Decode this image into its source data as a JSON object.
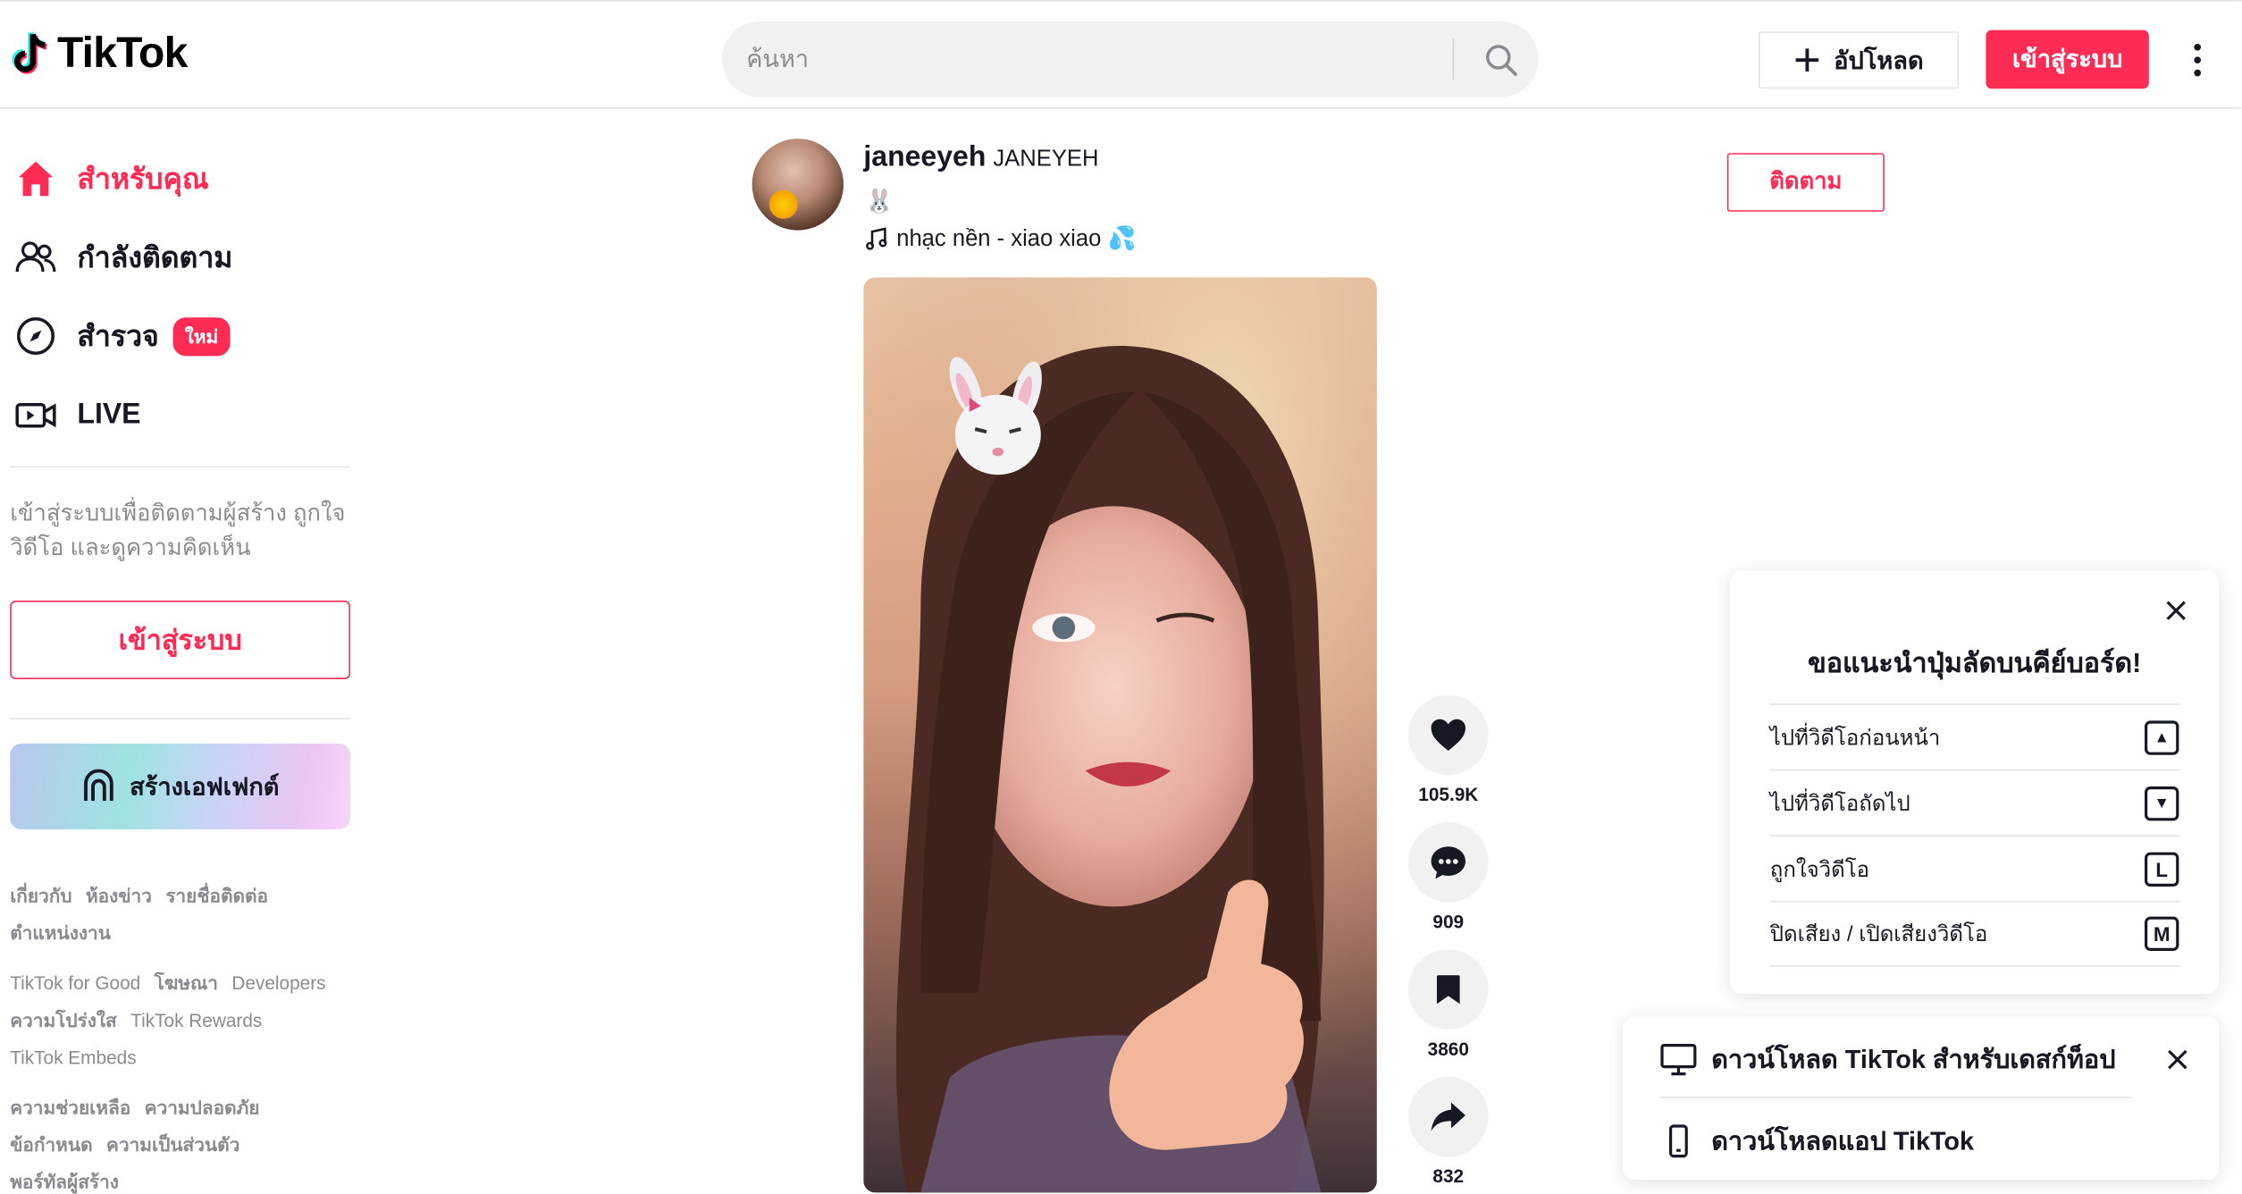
{
  "colors": {
    "brand": "#fe2c55",
    "text": "#161823",
    "muted": "#8a8b91"
  },
  "header": {
    "logo_text": "TikTok",
    "search_placeholder": "ค้นหา",
    "upload_label": "อัปโหลด",
    "login_label": "เข้าสู่ระบบ"
  },
  "sidebar": {
    "nav": [
      {
        "label": "สำหรับคุณ",
        "icon": "home-icon"
      },
      {
        "label": "กำลังติดตาม",
        "icon": "following-users-icon"
      },
      {
        "label": "สำรวจ",
        "icon": "compass-icon",
        "badge": "ใหม่"
      },
      {
        "label": "LIVE",
        "icon": "live-camera-icon"
      }
    ],
    "login_hint": "เข้าสู่ระบบเพื่อติดตามผู้สร้าง ถูกใจวิดีโอ และดูความคิดเห็น",
    "login_button": "เข้าสู่ระบบ",
    "effect_button": "สร้างเอฟเฟกต์",
    "footer": {
      "group1": [
        "เกี่ยวกับ",
        "ห้องข่าว",
        "รายชื่อติดต่อ",
        "ตำแหน่งงาน"
      ],
      "group2": [
        "TikTok for Good",
        "โฆษณา",
        "Developers",
        "ความโปร่งใส",
        "TikTok Rewards",
        "TikTok Embeds"
      ],
      "group3": [
        "ความช่วยเหลือ",
        "ความปลอดภัย",
        "ข้อกำหนด",
        "ความเป็นส่วนตัว",
        "พอร์ทัลผู้สร้าง"
      ]
    }
  },
  "post": {
    "author_name": "janeeyeh",
    "author_nickname": "JANEYEH",
    "caption_emoji": "🐰",
    "music": "nhạc nền - xiao xiao 💦",
    "follow_label": "ติดตาม",
    "actions": [
      {
        "icon": "heart-icon",
        "count": "105.9K"
      },
      {
        "icon": "comment-icon",
        "count": "909"
      },
      {
        "icon": "bookmark-icon",
        "count": "3860"
      },
      {
        "icon": "share-icon",
        "count": "832"
      }
    ]
  },
  "keyboard_panel": {
    "title": "ขอแนะนำปุ่มลัดบนคีย์บอร์ด!",
    "rows": [
      {
        "label": "ไปที่วิดีโอก่อนหน้า",
        "key": "▲"
      },
      {
        "label": "ไปที่วิดีโอถัดไป",
        "key": "▼"
      },
      {
        "label": "ถูกใจวิดีโอ",
        "key": "L"
      },
      {
        "label": "ปิดเสียง / เปิดเสียงวิดีโอ",
        "key": "M"
      }
    ]
  },
  "download_panel": {
    "desktop_label": "ดาวน์โหลด TikTok สำหรับเดสก์ท็อป",
    "app_label": "ดาวน์โหลดแอป TikTok"
  }
}
